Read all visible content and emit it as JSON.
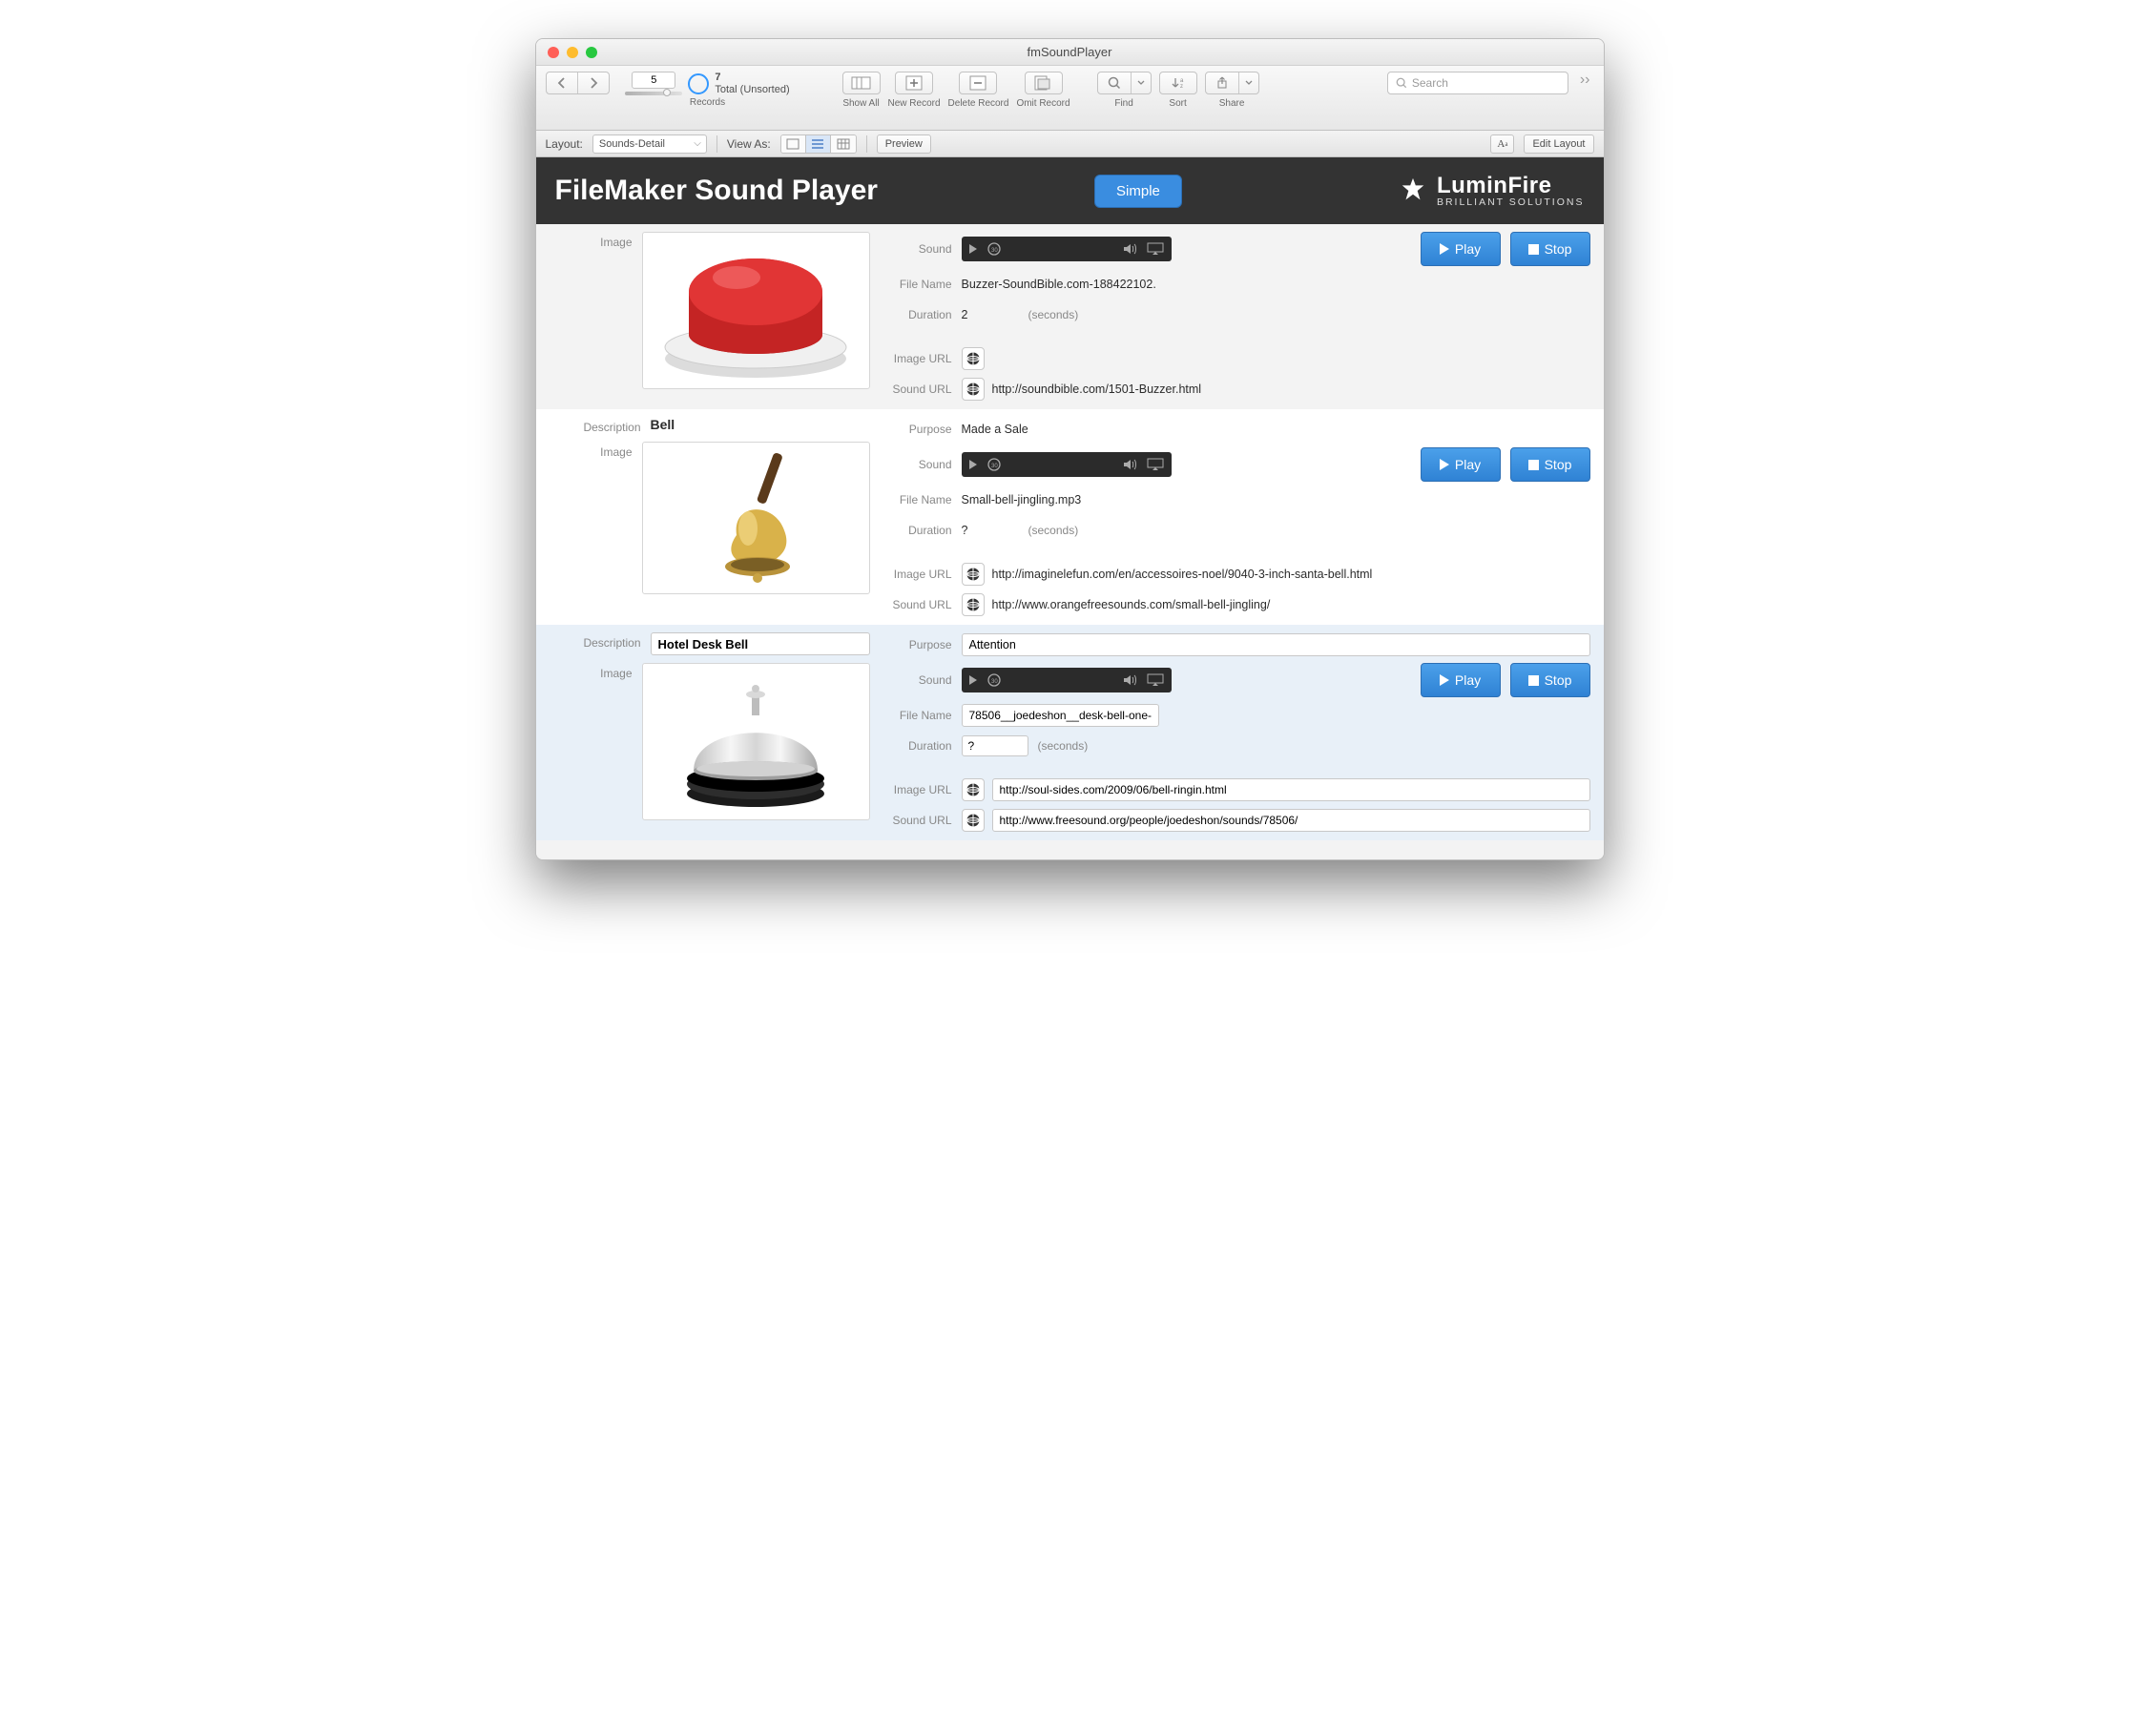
{
  "window": {
    "title": "fmSoundPlayer"
  },
  "toolbar": {
    "record_current": "5",
    "record_total": "7",
    "total_label": "Total (Unsorted)",
    "records_label": "Records",
    "show_all": "Show All",
    "new_record": "New Record",
    "delete_record": "Delete Record",
    "omit_record": "Omit Record",
    "find": "Find",
    "sort": "Sort",
    "share": "Share",
    "search_placeholder": "Search"
  },
  "layoutbar": {
    "layout_label": "Layout:",
    "layout_value": "Sounds-Detail",
    "view_as": "View As:",
    "preview": "Preview",
    "edit_layout": "Edit Layout"
  },
  "header": {
    "title": "FileMaker Sound Player",
    "mode_button": "Simple",
    "brand": "LuminFire",
    "tagline": "BRILLIANT SOLUTIONS"
  },
  "labels": {
    "description": "Description",
    "image": "Image",
    "purpose": "Purpose",
    "sound": "Sound",
    "file_name": "File Name",
    "duration": "Duration",
    "image_url": "Image URL",
    "sound_url": "Sound URL",
    "seconds": "(seconds)",
    "play": "Play",
    "stop": "Stop"
  },
  "records": [
    {
      "file_name": "Buzzer-SoundBible.com-188422102.",
      "duration": "2",
      "image_url": "",
      "sound_url": "http://soundbible.com/1501-Buzzer.html"
    },
    {
      "description": "Bell",
      "purpose": "Made a Sale",
      "file_name": "Small-bell-jingling.mp3",
      "duration": "?",
      "image_url": "http://imaginelefun.com/en/accessoires-noel/9040-3-inch-santa-bell.html",
      "sound_url": "http://www.orangefreesounds.com/small-bell-jingling/"
    },
    {
      "description": "Hotel Desk Bell",
      "purpose": "Attention",
      "file_name": "78506__joedeshon__desk-bell-one-",
      "duration": "?",
      "image_url": "http://soul-sides.com/2009/06/bell-ringin.html",
      "sound_url": "http://www.freesound.org/people/joedeshon/sounds/78506/"
    }
  ]
}
